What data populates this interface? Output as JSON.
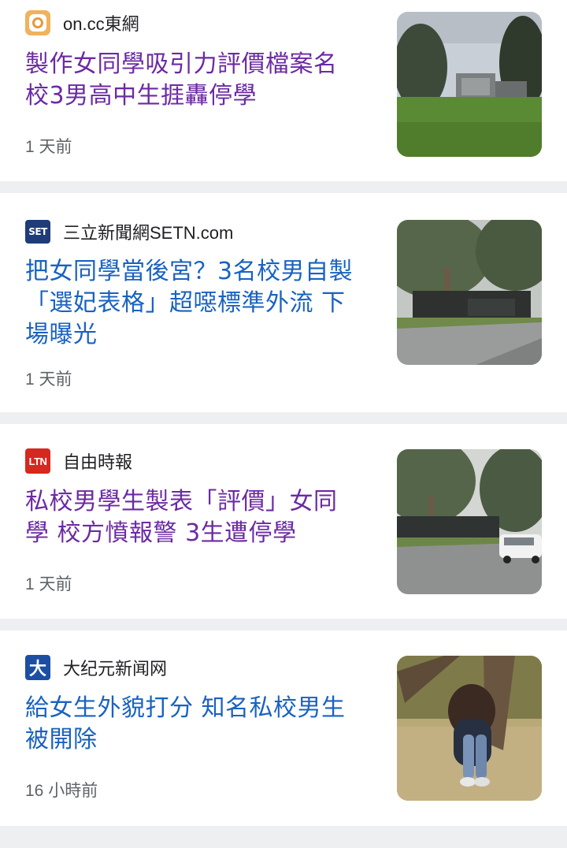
{
  "articles": [
    {
      "source": "on.cc東網",
      "source_icon": "oncc-logo-icon",
      "headline": "製作女同學吸引力評價檔案名校3男高中生捱轟停學",
      "headline_lines": [
        "製作女同學吸引力評價檔案名",
        "校3男高中生捱轟停學"
      ],
      "time": "1 天前",
      "visited": true,
      "thumbnail": "school-gate-lawn-image"
    },
    {
      "source": "三立新聞網SETN.com",
      "source_icon": "setn-logo-icon",
      "source_icon_text": "SET",
      "headline_lines": [
        "把女同學當後宮？3名校男自製",
        "「選妃表格」超噁標準外流 下",
        "場曝光"
      ],
      "time": "1 天前",
      "visited": false,
      "thumbnail": "school-entrance-trees-image"
    },
    {
      "source": "自由時報",
      "source_icon": "ltn-logo-icon",
      "source_icon_text": "LTN",
      "headline_lines": [
        "私校男學生製表「評價」女同",
        "學 校方憤報警 3生遭停學"
      ],
      "time": "1 天前",
      "visited": true,
      "thumbnail": "school-road-car-image"
    },
    {
      "source": "大纪元新闻网",
      "source_icon": "epoch-logo-icon",
      "source_icon_text": "大",
      "headline_lines": [
        "給女生外貌打分 知名私校男生",
        "被開除"
      ],
      "time": "16 小時前",
      "visited": false,
      "thumbnail": "girl-under-tree-image"
    }
  ],
  "colors": {
    "visited_link": "#6b2aa3",
    "unvisited_link": "#1a62c0",
    "meta_text": "#5f6368",
    "separator": "#eeeff1"
  }
}
